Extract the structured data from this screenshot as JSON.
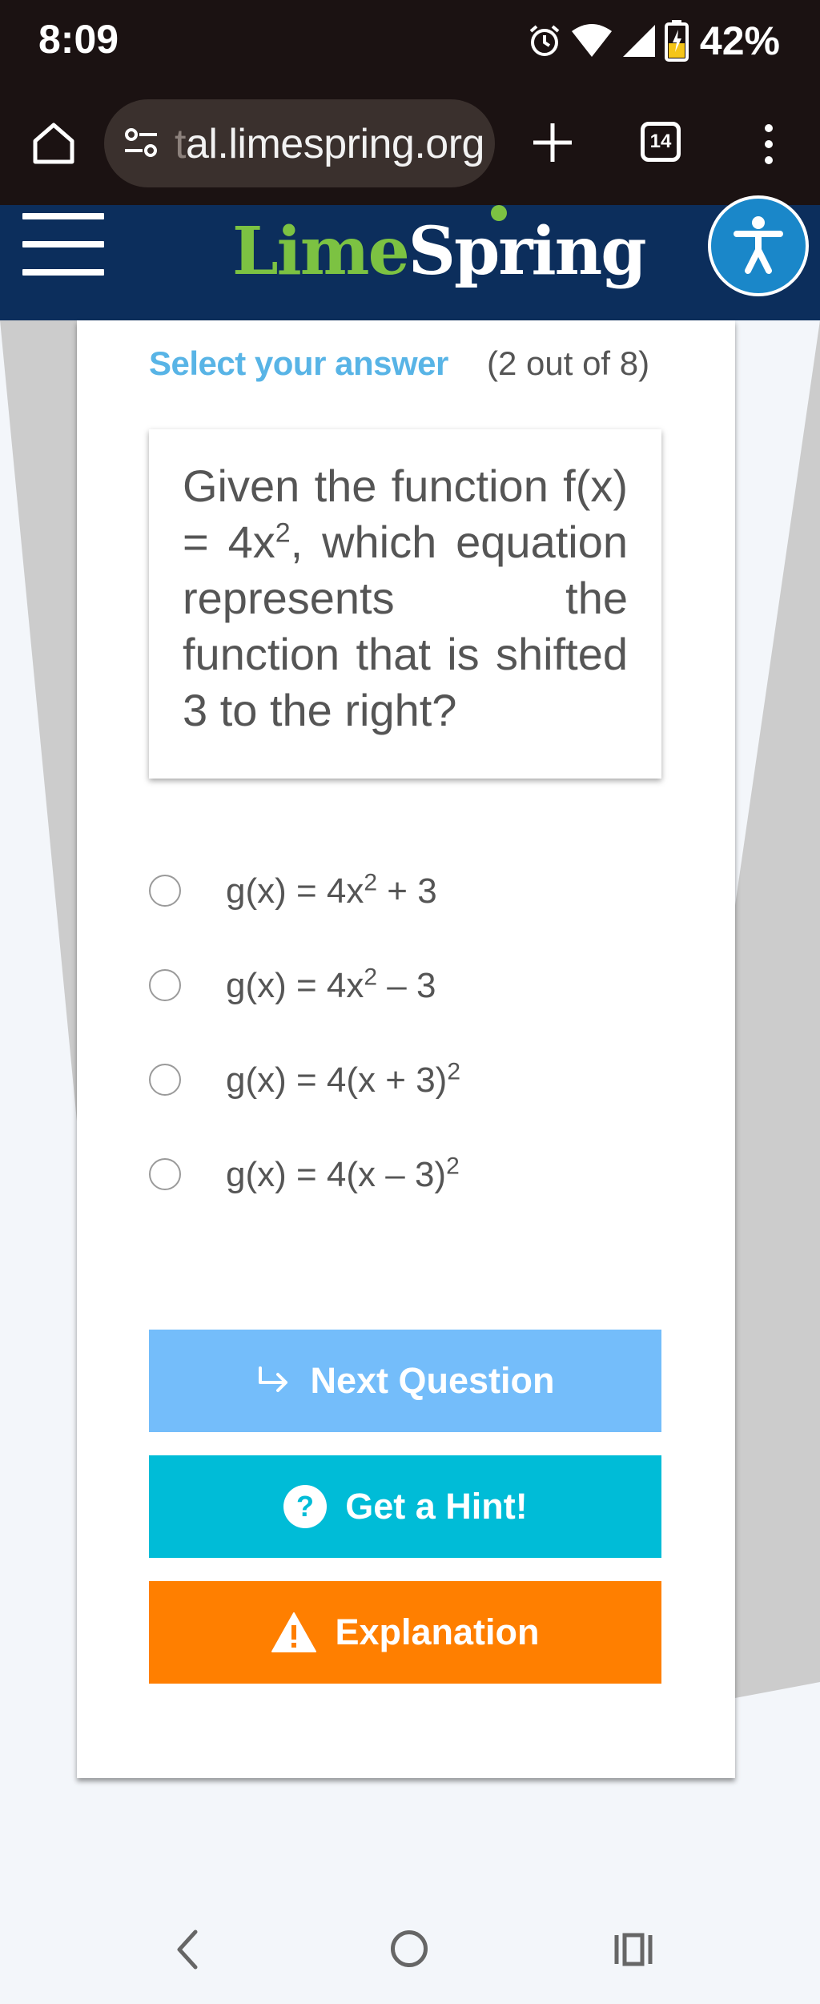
{
  "status_bar": {
    "time": "8:09",
    "battery_percent": "42%",
    "icons": [
      "alarm-icon",
      "wifi-icon",
      "signal-icon",
      "battery-charging-icon"
    ]
  },
  "browser": {
    "url_prefix": "t",
    "url": "al.limespring.org",
    "tab_count": "14",
    "icons": [
      "home-icon",
      "site-settings-icon",
      "plus-icon",
      "tabs-icon",
      "more-vert-icon"
    ]
  },
  "site": {
    "logo_lime": "Lime",
    "logo_spring": "Spring",
    "icons": [
      "hamburger-menu-icon",
      "accessibility-icon"
    ],
    "colors": {
      "header": "#0c2e5c",
      "lime": "#7cc242"
    }
  },
  "quiz": {
    "select_label": "Select your answer",
    "progress": "(2 out of 8)",
    "question": {
      "part1": "Given the function f(x) = 4x",
      "sup": "2",
      "part2": ", which equation represents the function that is shifted 3 to the right?"
    },
    "options": [
      {
        "pre": "g(x) = 4x",
        "sup": "2",
        "post": " + 3"
      },
      {
        "pre": "g(x) = 4x",
        "sup": "2",
        "post": " – 3"
      },
      {
        "pre": "g(x) = 4(x + 3)",
        "sup": "2",
        "post": ""
      },
      {
        "pre": "g(x) = 4(x – 3)",
        "sup": "2",
        "post": ""
      }
    ],
    "buttons": {
      "next": "Next Question",
      "hint": "Get a Hint!",
      "explanation": "Explanation"
    },
    "colors": {
      "next": "#74bdfa",
      "hint": "#00bcd7",
      "explanation": "#ff7f00",
      "select_label": "#58b4e6"
    }
  },
  "nav_bar": {
    "icons": [
      "back-icon",
      "home-circle-icon",
      "recents-icon"
    ]
  }
}
